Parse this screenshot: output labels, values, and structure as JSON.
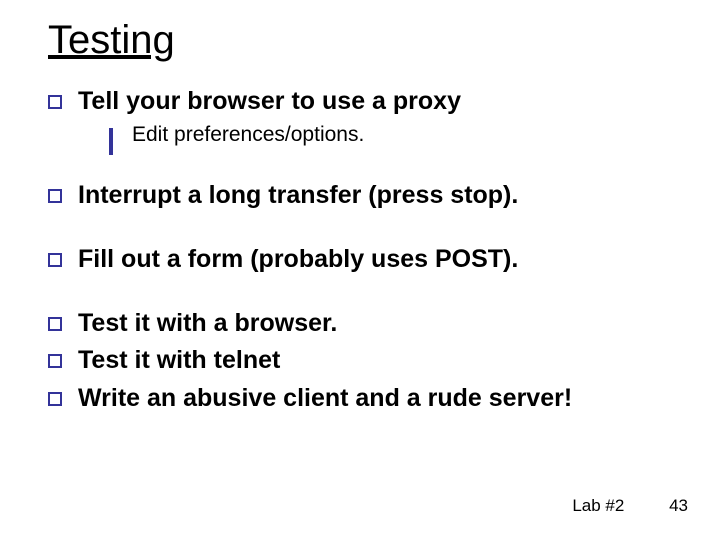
{
  "title": "Testing",
  "bullets": {
    "b1": "Tell your browser to use a proxy",
    "b1a": "Edit preferences/options.",
    "b2": "Interrupt a long transfer (press stop).",
    "b3": "Fill out a form (probably uses POST).",
    "b4": "Test it with a browser.",
    "b5": "Test it with telnet",
    "b6": "Write an abusive client and a rude server!"
  },
  "footer": {
    "label": "Lab #2",
    "page": "43"
  }
}
